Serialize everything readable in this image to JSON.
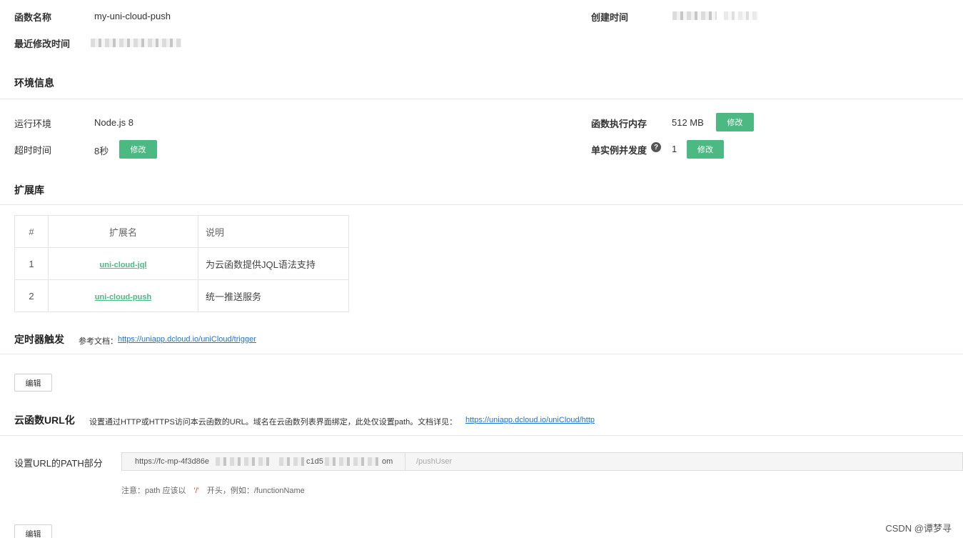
{
  "basic": {
    "func_name_label": "函数名称",
    "func_name_value": "my-uni-cloud-push",
    "created_label": "创建时间",
    "modified_label": "最近修改时间"
  },
  "env": {
    "title": "环境信息",
    "runtime_label": "运行环境",
    "runtime_value": "Node.js 8",
    "memory_label": "函数执行内存",
    "memory_value": "512 MB",
    "memory_edit": "修改",
    "timeout_label": "超时时间",
    "timeout_value": "8秒",
    "timeout_edit": "修改",
    "concurrency_label": "单实例并发度",
    "concurrency_help": "?",
    "concurrency_value": "1",
    "concurrency_edit": "修改"
  },
  "extensions": {
    "title": "扩展库",
    "headers": [
      "#",
      "扩展名",
      "说明"
    ],
    "rows": [
      {
        "num": "1",
        "name": "uni-cloud-jql",
        "desc": "为云函数提供JQL语法支持"
      },
      {
        "num": "2",
        "name": "uni-cloud-push",
        "desc": "统一推送服务"
      }
    ]
  },
  "timer": {
    "title": "定时器触发",
    "ref_label": "参考文档：",
    "ref_link": "https://uniapp.dcloud.io/uniCloud/trigger",
    "edit": "编辑"
  },
  "url": {
    "title": "云函数URL化",
    "desc": "设置通过HTTP或HTTPS访问本云函数的URL。域名在云函数列表界面绑定，此处仅设置path。文档详见：",
    "doc_link": "https://uniapp.dcloud.io/uniCloud/http",
    "path_label": "设置URL的PATH部分",
    "prefix_start": "https://fc-mp-4f3d86e",
    "prefix_mid": "c1d5",
    "prefix_end": "om",
    "path_placeholder": "/pushUser",
    "note_prefix": "注意：path 应该以",
    "note_slash": "'/'",
    "note_suffix": "开头，例如：/functionName",
    "edit": "编辑"
  },
  "watermark": "CSDN @谭梦寻"
}
